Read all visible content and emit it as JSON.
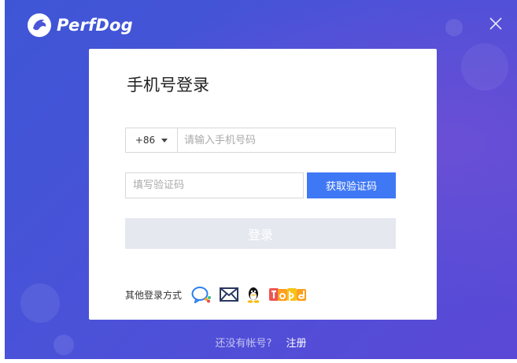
{
  "app": {
    "name": "PerfDog"
  },
  "card": {
    "title": "手机号登录",
    "country_code": "+86",
    "phone_placeholder": "请输入手机号码",
    "code_placeholder": "填写验证码",
    "get_code_label": "获取验证码",
    "login_label": "登录",
    "other_login_label": "其他登录方式",
    "other_login_icons": [
      "wechat-work-icon",
      "email-icon",
      "qq-icon",
      "tapd-icon"
    ]
  },
  "footer": {
    "question": "还没有帐号?",
    "register_label": "注册"
  },
  "colors": {
    "primary": "#3f78f5",
    "login_disabled": "#e5e8ef",
    "bg_start": "#3e56d6",
    "bg_end": "#5b48d6"
  }
}
